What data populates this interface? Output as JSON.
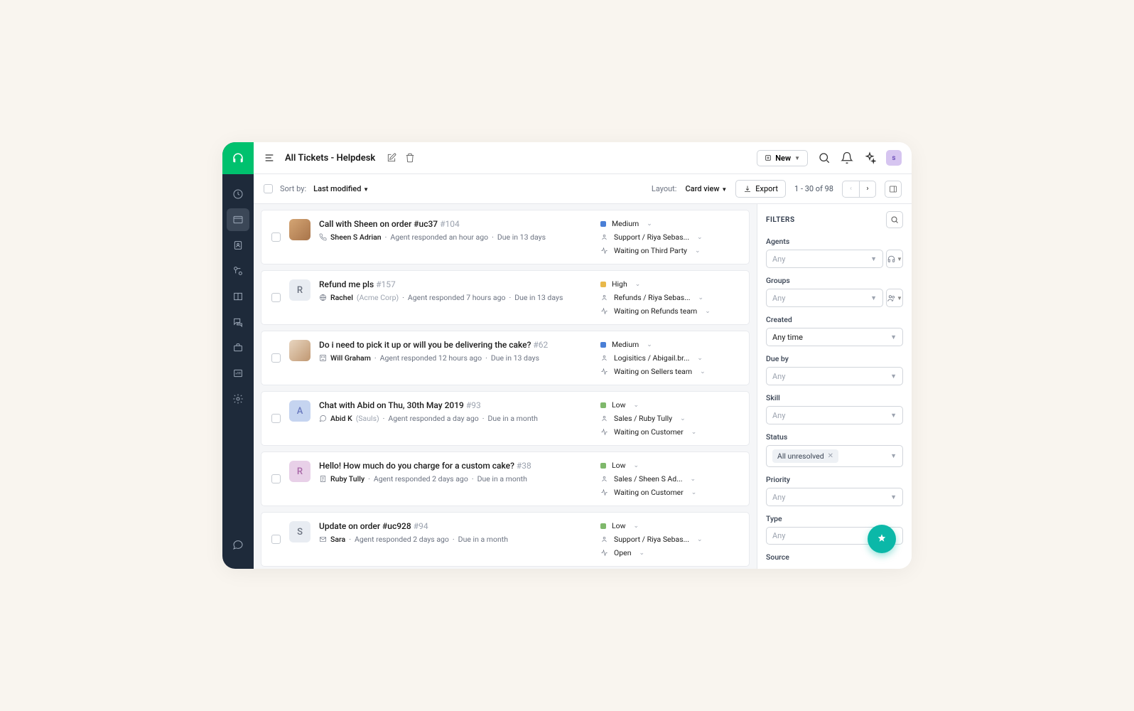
{
  "header": {
    "title": "All Tickets - Helpdesk",
    "newButton": "New",
    "userInitial": "s"
  },
  "toolbar": {
    "sortByLabel": "Sort by:",
    "sortByValue": "Last modified",
    "layoutLabel": "Layout:",
    "layoutValue": "Card view",
    "exportLabel": "Export",
    "pagination": "1 - 30 of 98"
  },
  "tickets": [
    {
      "title": "Call with Sheen on order #uc37",
      "ticketId": "#104",
      "channelIcon": "phone",
      "reporter": "Sheen S Adrian",
      "corp": "",
      "responded": "Agent responded an hour ago",
      "due": "Due in 13 days",
      "priority": "Medium",
      "prioClass": "prio-medium",
      "group": "Support / Riya Sebas...",
      "status": "Waiting on Third Party",
      "avatarType": "img1",
      "avatarLetter": ""
    },
    {
      "title": "Refund me pls",
      "ticketId": "#157",
      "channelIcon": "globe",
      "reporter": "Rachel",
      "corp": "(Acme Corp)",
      "responded": "Agent responded 7 hours ago",
      "due": "Due in 13 days",
      "priority": "High",
      "prioClass": "prio-high",
      "group": "Refunds / Riya Sebas...",
      "status": "Waiting on Refunds team",
      "avatarType": "letter-r",
      "avatarLetter": "R"
    },
    {
      "title": "Do i need to pick it up or will you be delivering the cake?",
      "ticketId": "#62",
      "channelIcon": "social",
      "reporter": "Will Graham",
      "corp": "",
      "responded": "Agent responded 12 hours ago",
      "due": "Due in 13 days",
      "priority": "Medium",
      "prioClass": "prio-medium",
      "group": "Logisitics / Abigail.br...",
      "status": "Waiting on Sellers team",
      "avatarType": "img2",
      "avatarLetter": ""
    },
    {
      "title": "Chat with Abid on Thu, 30th May 2019",
      "ticketId": "#93",
      "channelIcon": "chat",
      "reporter": "Abid K",
      "corp": "(Sauls)",
      "responded": "Agent responded a day ago",
      "due": "Due in a month",
      "priority": "Low",
      "prioClass": "prio-low",
      "group": "Sales / Ruby Tully",
      "status": "Waiting on Customer",
      "avatarType": "letter-a",
      "avatarLetter": "A"
    },
    {
      "title": "Hello! How much do you charge for a custom cake?",
      "ticketId": "#38",
      "channelIcon": "form",
      "reporter": "Ruby Tully",
      "corp": "",
      "responded": "Agent responded 2 days ago",
      "due": "Due in a month",
      "priority": "Low",
      "prioClass": "prio-low",
      "group": "Sales / Sheen S Ad...",
      "status": "Waiting on Customer",
      "avatarType": "letter-r2",
      "avatarLetter": "R"
    },
    {
      "title": "Update on order #uc928",
      "ticketId": "#94",
      "channelIcon": "mail",
      "reporter": "Sara",
      "corp": "",
      "responded": "Agent responded 2 days ago",
      "due": "Due in a month",
      "priority": "Low",
      "prioClass": "prio-low",
      "group": "Support / Riya Sebas...",
      "status": "Open",
      "avatarType": "letter-s",
      "avatarLetter": "S"
    }
  ],
  "filters": {
    "title": "FILTERS",
    "agents": {
      "label": "Agents",
      "placeholder": "Any"
    },
    "groups": {
      "label": "Groups",
      "placeholder": "Any"
    },
    "created": {
      "label": "Created",
      "value": "Any time"
    },
    "dueBy": {
      "label": "Due by",
      "placeholder": "Any"
    },
    "skill": {
      "label": "Skill",
      "placeholder": "Any"
    },
    "status": {
      "label": "Status",
      "chip": "All unresolved"
    },
    "priority": {
      "label": "Priority",
      "placeholder": "Any"
    },
    "type": {
      "label": "Type",
      "placeholder": "Any"
    },
    "source": {
      "label": "Source"
    }
  }
}
